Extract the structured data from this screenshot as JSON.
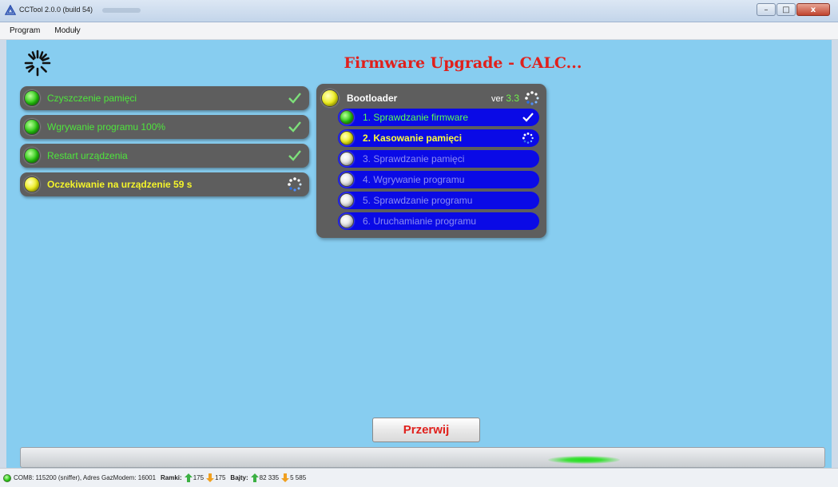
{
  "window": {
    "title": "CCTool 2.0.0 (build 54)",
    "minimize_label": "–",
    "maximize_label": "□",
    "close_label": "x"
  },
  "menu": [
    {
      "label": "Program"
    },
    {
      "label": "Moduły"
    }
  ],
  "header": {
    "title": "Firmware Upgrade - CALC..."
  },
  "tasks": [
    {
      "label": "Czyszczenie pamięci",
      "state": "done"
    },
    {
      "label": "Wgrywanie programu 100%",
      "state": "done"
    },
    {
      "label": "Restart urządzenia",
      "state": "done"
    },
    {
      "label": "Oczekiwanie na urządzenie 59 s",
      "state": "active"
    }
  ],
  "bootloader": {
    "title": "Bootloader",
    "ver_label": "ver",
    "ver_value": "3.3",
    "steps": [
      {
        "label": "1. Sprawdzanie firmware",
        "state": "done"
      },
      {
        "label": "2. Kasowanie pamięci",
        "state": "active"
      },
      {
        "label": "3. Sprawdzanie pamięci",
        "state": "pending"
      },
      {
        "label": "4. Wgrywanie programu",
        "state": "pending"
      },
      {
        "label": "5. Sprawdzanie programu",
        "state": "pending"
      },
      {
        "label": "6. Uruchamianie programu",
        "state": "pending"
      }
    ]
  },
  "abort_button": "Przerwij",
  "progress": {
    "indicator_position": 0.72
  },
  "status": {
    "port": "COM8: 115200 (sniffer), Adres GazModem: 16001",
    "frames_label": "Ramki:",
    "frames_up": "175",
    "frames_down": "175",
    "bytes_label": "Bajty:",
    "bytes_up": "82 335",
    "bytes_down": "5 585"
  },
  "colors": {
    "background": "#87cdf0",
    "title_red": "#e0201c",
    "done_green": "#4ee63c",
    "active_yellow": "#f5f52a",
    "step_blue": "#0a0ae6"
  },
  "icons": {
    "app": "cctool-logo-icon",
    "loading": "spinner-icon",
    "done": "checkmark-icon",
    "busy": "busy-dots-icon",
    "up": "arrow-up-icon",
    "down": "arrow-down-icon"
  }
}
